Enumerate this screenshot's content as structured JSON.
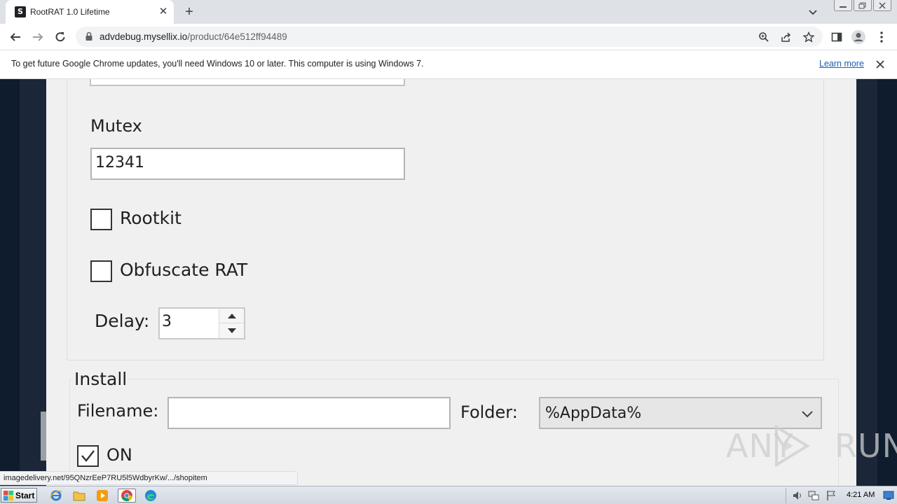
{
  "browser": {
    "tab_title": "RootRAT 1.0 Lifetime",
    "favicon_letter": "S",
    "url_host": "advdebug.mysellix.io",
    "url_path": "/product/64e512ff94489"
  },
  "infobar": {
    "message": "To get future Google Chrome updates, you'll need Windows 10 or later. This computer is using Windows 7.",
    "link": "Learn more"
  },
  "form": {
    "mutex_label": "Mutex",
    "mutex_value": "12341",
    "rootkit_label": "Rootkit",
    "rootkit_checked": false,
    "obfuscate_label": "Obfuscate RAT",
    "obfuscate_checked": false,
    "delay_label": "Delay:",
    "delay_value": "3"
  },
  "install": {
    "group_label": "Install",
    "filename_label": "Filename:",
    "filename_value": "",
    "folder_label": "Folder:",
    "folder_value": "%AppData%",
    "on_label": "ON",
    "on_checked": true
  },
  "watermark": {
    "left": "ANY",
    "right": "RUN"
  },
  "status_url": "imagedelivery.net/95QNzrEeP7RU5l5WdbyrKw/.../shopitem",
  "taskbar": {
    "start_label": "Start",
    "clock": "4:21 AM"
  },
  "colors": {
    "link": "#1a5fb4",
    "page_bg": "#0f1c2e"
  }
}
